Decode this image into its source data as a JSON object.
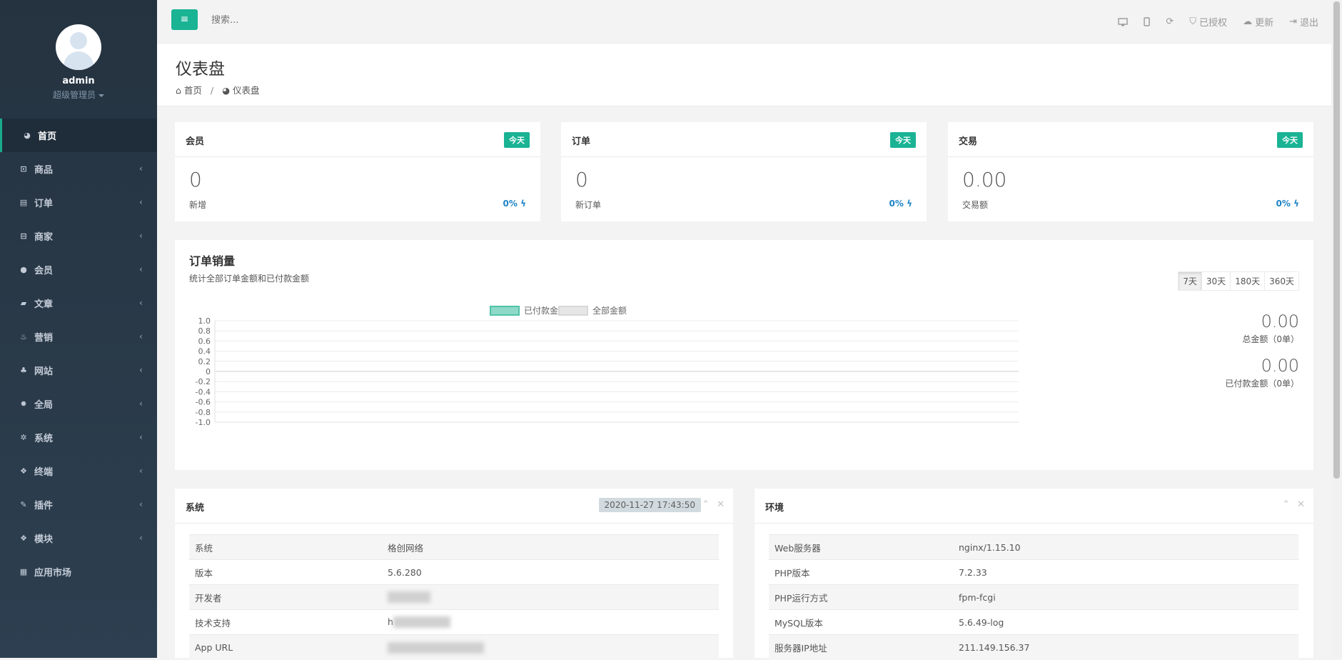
{
  "profile": {
    "name": "admin",
    "role": "超级管理员"
  },
  "nav": [
    {
      "label": "首页",
      "icon": "dashboard-icon",
      "glyph": "◕",
      "active": true,
      "arrow": false
    },
    {
      "label": "商品",
      "icon": "shopping-bag-icon",
      "glyph": "⊡",
      "active": false,
      "arrow": true
    },
    {
      "label": "订单",
      "icon": "list-icon",
      "glyph": "▤",
      "active": false,
      "arrow": true
    },
    {
      "label": "商家",
      "icon": "store-icon",
      "glyph": "⊟",
      "active": false,
      "arrow": true
    },
    {
      "label": "会员",
      "icon": "user-icon",
      "glyph": "●",
      "active": false,
      "arrow": true
    },
    {
      "label": "文章",
      "icon": "book-icon",
      "glyph": "▰",
      "active": false,
      "arrow": true
    },
    {
      "label": "营销",
      "icon": "fire-icon",
      "glyph": "♨",
      "active": false,
      "arrow": true
    },
    {
      "label": "网站",
      "icon": "sitemap-icon",
      "glyph": "♣",
      "active": false,
      "arrow": true
    },
    {
      "label": "全局",
      "icon": "gear-icon",
      "glyph": "✹",
      "active": false,
      "arrow": true
    },
    {
      "label": "系统",
      "icon": "gears-icon",
      "glyph": "✲",
      "active": false,
      "arrow": true
    },
    {
      "label": "终端",
      "icon": "cubes-icon",
      "glyph": "❖",
      "active": false,
      "arrow": true
    },
    {
      "label": "插件",
      "icon": "plug-icon",
      "glyph": "✎",
      "active": false,
      "arrow": true
    },
    {
      "label": "模块",
      "icon": "cubes-icon",
      "glyph": "❖",
      "active": false,
      "arrow": true
    },
    {
      "label": "应用市场",
      "icon": "grid-icon",
      "glyph": "▦",
      "active": false,
      "arrow": false
    }
  ],
  "topbar": {
    "search_placeholder": "搜索...",
    "authorized": "已授权",
    "update": "更新",
    "logout": "退出"
  },
  "page": {
    "title": "仪表盘",
    "breadcrumb_home": "首页",
    "breadcrumb_current": "仪表盘"
  },
  "stats": {
    "members": {
      "title": "会员",
      "badge": "今天",
      "value": "0",
      "sub": "新增",
      "pct": "0%"
    },
    "orders": {
      "title": "订单",
      "badge": "今天",
      "value": "0",
      "sub": "新订单",
      "pct": "0%"
    },
    "trades": {
      "title": "交易",
      "badge": "今天",
      "value": "0.00",
      "sub": "交易额",
      "pct": "0%"
    }
  },
  "sales": {
    "title": "订单销量",
    "subtitle": "统计全部订单金额和已付款金额",
    "ranges": [
      "7天",
      "30天",
      "180天",
      "360天"
    ],
    "total_value": "0.00",
    "total_label": "总金额（0单）",
    "paid_value": "0.00",
    "paid_label": "已付款金额（0单）"
  },
  "chart_data": {
    "type": "line",
    "categories": [],
    "series": [
      {
        "name": "已付款金额",
        "values": [],
        "color": "#8fd9c8"
      },
      {
        "name": "全部金额",
        "values": [],
        "color": "#e6e6e6"
      }
    ],
    "yticks": [
      "1.0",
      "0.8",
      "0.6",
      "0.4",
      "0.2",
      "0",
      "-0.2",
      "-0.4",
      "-0.6",
      "-0.8",
      "-1.0"
    ],
    "ylim": [
      -1.0,
      1.0
    ],
    "grid": true,
    "legend": "top-center"
  },
  "system": {
    "title": "系统",
    "time": "2020-11-27 17:43:50",
    "rows": [
      {
        "k": "系统",
        "v": "格创网络"
      },
      {
        "k": "版本",
        "v": "5.6.280"
      },
      {
        "k": "开发者",
        "v": ""
      },
      {
        "k": "技术支持",
        "v": "h"
      },
      {
        "k": "App URL",
        "v": ""
      }
    ]
  },
  "env": {
    "title": "环境",
    "rows": [
      {
        "k": "Web服务器",
        "v": "nginx/1.15.10"
      },
      {
        "k": "PHP版本",
        "v": "7.2.33"
      },
      {
        "k": "PHP运行方式",
        "v": "fpm-fcgi"
      },
      {
        "k": "MySQL版本",
        "v": "5.6.49-log"
      },
      {
        "k": "服务器IP地址",
        "v": "211.149.156.37"
      }
    ]
  },
  "colors": {
    "accent": "#1ab394",
    "sidebar": "#2f4050",
    "link": "#1c84c6"
  }
}
